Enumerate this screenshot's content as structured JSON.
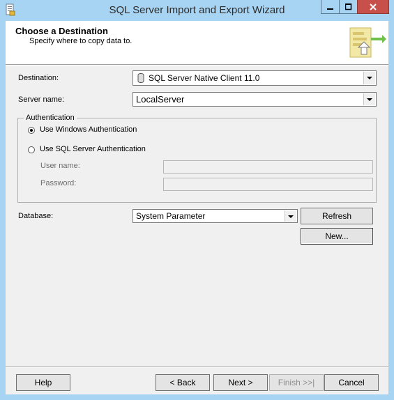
{
  "window": {
    "title": "SQL Server Import and Export Wizard",
    "accent_color": "#a8d4f3",
    "close_color": "#c7504b"
  },
  "header": {
    "title": "Choose a Destination",
    "subtitle": "Specify where to copy data to."
  },
  "form": {
    "destination_label": "Destination:",
    "destination_value": "SQL Server Native Client 11.0",
    "server_label": "Server name:",
    "server_value": "LocalServer",
    "auth_group_label": "Authentication",
    "auth_windows_label": "Use Windows Authentication",
    "auth_sql_label": "Use SQL Server Authentication",
    "auth_selected": "windows",
    "username_label": "User name:",
    "password_label": "Password:",
    "database_label": "Database:",
    "database_value": "System Parameter",
    "refresh_label": "Refresh",
    "new_label": "New..."
  },
  "footer": {
    "help_label": "Help",
    "back_label": "< Back",
    "next_label": "Next >",
    "finish_label": "Finish >>|",
    "cancel_label": "Cancel"
  }
}
